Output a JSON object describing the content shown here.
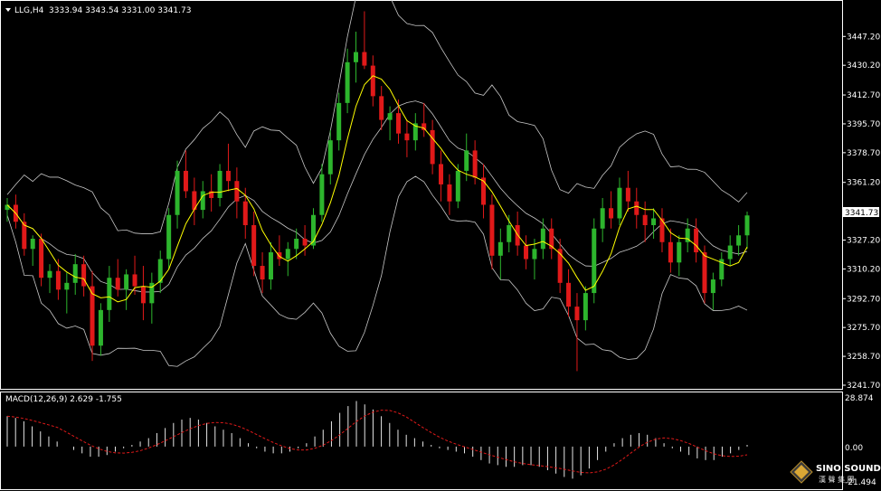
{
  "window": {
    "symbol": "LLG,H4",
    "ohlc": "3333.94 3343.54 3331.00 3341.73",
    "current_price": "3341.73",
    "colors": {
      "bull": "#2db52d",
      "bear": "#e01919",
      "ma": "#ffff00",
      "band": "#c8c8c8",
      "macd": "#e6e6e6",
      "signal": "#e01919",
      "grid": "#ffffff"
    }
  },
  "price_axis": {
    "ticks": [
      "3447.20",
      "3430.20",
      "3412.70",
      "3395.70",
      "3378.70",
      "3361.20",
      "3327.20",
      "3310.20",
      "3292.70",
      "3275.70",
      "3258.70",
      "3241.70"
    ]
  },
  "macd": {
    "label": "MACD(12,26,9) 2.629 -1.755",
    "ticks": [
      "28.874",
      "0.00",
      "-21.494"
    ]
  },
  "watermark": {
    "brand": "SINO SOUND",
    "sub": "漢 聲 集 團"
  },
  "chart_data": {
    "type": "candlestick",
    "title": "LLG,H4",
    "ylim": [
      3241.7,
      3466
    ],
    "macd_ylim": [
      -21.494,
      28.874
    ],
    "candles": [
      [
        3345,
        3352,
        3338,
        3348
      ],
      [
        3348,
        3354,
        3334,
        3338
      ],
      [
        3338,
        3343,
        3318,
        3322
      ],
      [
        3322,
        3330,
        3312,
        3328
      ],
      [
        3328,
        3331,
        3300,
        3305
      ],
      [
        3305,
        3313,
        3296,
        3309
      ],
      [
        3309,
        3316,
        3292,
        3298
      ],
      [
        3298,
        3308,
        3284,
        3302
      ],
      [
        3302,
        3319,
        3295,
        3313
      ],
      [
        3313,
        3318,
        3294,
        3300
      ],
      [
        3300,
        3309,
        3256,
        3265
      ],
      [
        3265,
        3290,
        3259,
        3286
      ],
      [
        3286,
        3312,
        3279,
        3305
      ],
      [
        3305,
        3316,
        3294,
        3298
      ],
      [
        3298,
        3310,
        3286,
        3307
      ],
      [
        3307,
        3318,
        3295,
        3300
      ],
      [
        3300,
        3312,
        3280,
        3290
      ],
      [
        3290,
        3308,
        3278,
        3302
      ],
      [
        3302,
        3321,
        3296,
        3316
      ],
      [
        3316,
        3346,
        3310,
        3342
      ],
      [
        3342,
        3374,
        3334,
        3368
      ],
      [
        3368,
        3380,
        3352,
        3356
      ],
      [
        3356,
        3364,
        3336,
        3345
      ],
      [
        3345,
        3362,
        3340,
        3356
      ],
      [
        3356,
        3366,
        3344,
        3352
      ],
      [
        3352,
        3372,
        3347,
        3368
      ],
      [
        3368,
        3384,
        3356,
        3362
      ],
      [
        3362,
        3370,
        3340,
        3350
      ],
      [
        3350,
        3358,
        3328,
        3336
      ],
      [
        3336,
        3344,
        3306,
        3312
      ],
      [
        3312,
        3320,
        3296,
        3304
      ],
      [
        3304,
        3326,
        3298,
        3320
      ],
      [
        3320,
        3330,
        3312,
        3316
      ],
      [
        3316,
        3326,
        3306,
        3322
      ],
      [
        3322,
        3334,
        3316,
        3328
      ],
      [
        3328,
        3336,
        3318,
        3324
      ],
      [
        3324,
        3346,
        3322,
        3342
      ],
      [
        3342,
        3372,
        3338,
        3366
      ],
      [
        3366,
        3392,
        3360,
        3386
      ],
      [
        3386,
        3414,
        3380,
        3408
      ],
      [
        3408,
        3440,
        3402,
        3432
      ],
      [
        3432,
        3450,
        3420,
        3438
      ],
      [
        3438,
        3462,
        3428,
        3430
      ],
      [
        3430,
        3436,
        3406,
        3412
      ],
      [
        3412,
        3418,
        3392,
        3398
      ],
      [
        3398,
        3406,
        3386,
        3402
      ],
      [
        3402,
        3410,
        3384,
        3390
      ],
      [
        3390,
        3398,
        3376,
        3386
      ],
      [
        3386,
        3402,
        3380,
        3396
      ],
      [
        3396,
        3408,
        3388,
        3392
      ],
      [
        3392,
        3398,
        3366,
        3372
      ],
      [
        3372,
        3380,
        3350,
        3360
      ],
      [
        3360,
        3366,
        3342,
        3350
      ],
      [
        3350,
        3372,
        3346,
        3368
      ],
      [
        3368,
        3390,
        3362,
        3380
      ],
      [
        3380,
        3386,
        3360,
        3364
      ],
      [
        3364,
        3372,
        3340,
        3348
      ],
      [
        3348,
        3354,
        3310,
        3318
      ],
      [
        3318,
        3334,
        3304,
        3326
      ],
      [
        3326,
        3342,
        3320,
        3336
      ],
      [
        3336,
        3344,
        3318,
        3324
      ],
      [
        3324,
        3330,
        3310,
        3316
      ],
      [
        3316,
        3328,
        3304,
        3322
      ],
      [
        3322,
        3340,
        3316,
        3334
      ],
      [
        3334,
        3340,
        3316,
        3322
      ],
      [
        3322,
        3328,
        3296,
        3302
      ],
      [
        3302,
        3310,
        3282,
        3288
      ],
      [
        3288,
        3296,
        3250,
        3280
      ],
      [
        3280,
        3300,
        3274,
        3296
      ],
      [
        3296,
        3340,
        3290,
        3334
      ],
      [
        3334,
        3352,
        3326,
        3346
      ],
      [
        3346,
        3356,
        3334,
        3340
      ],
      [
        3340,
        3364,
        3336,
        3358
      ],
      [
        3358,
        3368,
        3344,
        3350
      ],
      [
        3350,
        3358,
        3334,
        3342
      ],
      [
        3342,
        3350,
        3326,
        3336
      ],
      [
        3336,
        3346,
        3328,
        3340
      ],
      [
        3340,
        3346,
        3320,
        3326
      ],
      [
        3326,
        3334,
        3308,
        3314
      ],
      [
        3314,
        3330,
        3306,
        3326
      ],
      [
        3326,
        3340,
        3320,
        3334
      ],
      [
        3334,
        3340,
        3314,
        3320
      ],
      [
        3320,
        3324,
        3290,
        3296
      ],
      [
        3296,
        3308,
        3286,
        3304
      ],
      [
        3304,
        3320,
        3300,
        3316
      ],
      [
        3316,
        3330,
        3312,
        3324
      ],
      [
        3324,
        3336,
        3318,
        3330
      ],
      [
        3330,
        3344,
        3322,
        3341.73
      ]
    ],
    "macd_hist": [
      18,
      17,
      15,
      12,
      9,
      6,
      3,
      0,
      -2,
      -4,
      -6,
      -6,
      -5,
      -3,
      -1,
      1,
      3,
      5,
      8,
      11,
      14,
      16,
      17,
      16,
      14,
      12,
      10,
      8,
      5,
      2,
      -1,
      -3,
      -4,
      -4,
      -3,
      -1,
      2,
      6,
      10,
      15,
      20,
      24,
      27,
      25,
      22,
      18,
      14,
      10,
      7,
      5,
      3,
      1,
      -1,
      -2,
      -3,
      -4,
      -6,
      -8,
      -10,
      -11,
      -12,
      -12,
      -11,
      -11,
      -12,
      -14,
      -16,
      -18,
      -19,
      -17,
      -13,
      -8,
      -3,
      2,
      5,
      7,
      8,
      7,
      5,
      2,
      -1,
      -3,
      -5,
      -7,
      -8,
      -8,
      -6,
      -4,
      -2,
      1
    ]
  }
}
